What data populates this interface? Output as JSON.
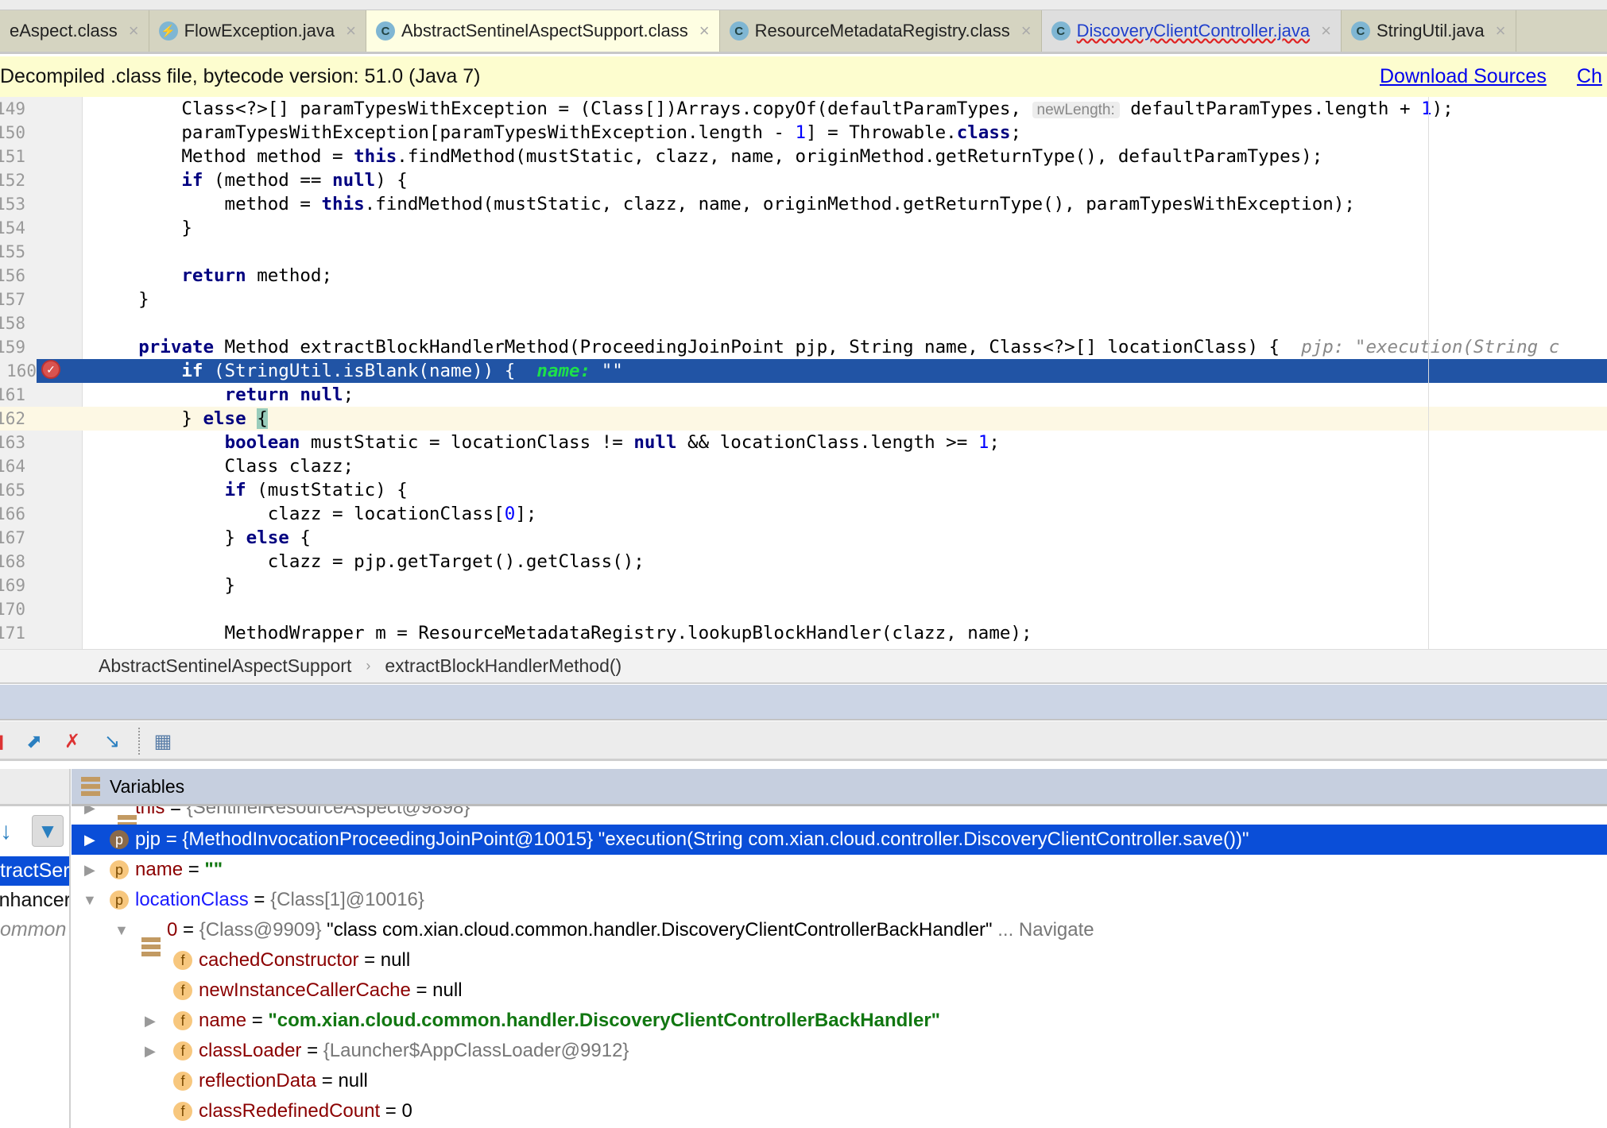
{
  "tabs": [
    {
      "label": "eAspect.class",
      "icon": "",
      "state": "normal"
    },
    {
      "label": "FlowException.java",
      "icon": "⚡",
      "state": "normal"
    },
    {
      "label": "AbstractSentinelAspectSupport.class",
      "icon": "C",
      "state": "active"
    },
    {
      "label": "ResourceMetadataRegistry.class",
      "icon": "C",
      "state": "normal"
    },
    {
      "label": "DiscoveryClientController.java",
      "icon": "C",
      "state": "link"
    },
    {
      "label": "StringUtil.java",
      "icon": "C",
      "state": "normal"
    }
  ],
  "tab_close": "×",
  "banner": {
    "text": "Decompiled .class file, bytecode version: 51.0 (Java 7)",
    "download": "Download Sources",
    "choose": "Ch"
  },
  "colors": {
    "selection": "#2154a5",
    "tree_selection": "#0a4ed8",
    "current_line": "#fdf8e4",
    "keyword": "#000080",
    "number": "#0000ff",
    "string": "#117711"
  },
  "code": {
    "selected_line": "160",
    "current_line": "162",
    "breakpoint_line": "160",
    "lines": [
      {
        "no": "149",
        "t": [
          [
            "        Class<?>[] paramTypesWithException = (Class[])Arrays.copyOf(defaultParamTypes, ",
            ""
          ],
          [
            "newLength:",
            "h"
          ],
          [
            " defaultParamTypes.length + ",
            ""
          ],
          [
            "1",
            "n"
          ],
          [
            ");",
            ""
          ]
        ]
      },
      {
        "no": "150",
        "t": [
          [
            "        paramTypesWithException[paramTypesWithException.length - ",
            ""
          ],
          [
            "1",
            "n"
          ],
          [
            "] = Throwable.",
            ""
          ],
          [
            "class",
            "k"
          ],
          [
            ";",
            ""
          ]
        ]
      },
      {
        "no": "151",
        "t": [
          [
            "        Method method = ",
            ""
          ],
          [
            "this",
            "k"
          ],
          [
            ".findMethod(mustStatic, clazz, name, originMethod.getReturnType(), defaultParamTypes);",
            ""
          ]
        ]
      },
      {
        "no": "152",
        "t": [
          [
            "        ",
            ""
          ],
          [
            "if",
            "k"
          ],
          [
            " (method == ",
            ""
          ],
          [
            "null",
            "k"
          ],
          [
            ") {",
            ""
          ]
        ]
      },
      {
        "no": "153",
        "t": [
          [
            "            method = ",
            ""
          ],
          [
            "this",
            "k"
          ],
          [
            ".findMethod(mustStatic, clazz, name, originMethod.getReturnType(), paramTypesWithException);",
            ""
          ]
        ]
      },
      {
        "no": "154",
        "t": [
          [
            "        }",
            ""
          ]
        ]
      },
      {
        "no": "155",
        "t": []
      },
      {
        "no": "156",
        "t": [
          [
            "        ",
            ""
          ],
          [
            "return",
            "k"
          ],
          [
            " method;",
            ""
          ]
        ]
      },
      {
        "no": "157",
        "t": [
          [
            "    }",
            ""
          ]
        ]
      },
      {
        "no": "158",
        "t": []
      },
      {
        "no": "159",
        "t": [
          [
            "    ",
            ""
          ],
          [
            "private",
            "k"
          ],
          [
            " Method extractBlockHandlerMethod(ProceedingJoinPoint pjp, String name, Class<?>[] locationClass) {  ",
            ""
          ],
          [
            "pjp: \"execution(String c",
            "i"
          ]
        ]
      },
      {
        "no": "160",
        "t": [
          [
            "        ",
            ""
          ],
          [
            "if",
            "k"
          ],
          [
            " (StringUtil.isBlank(name)) {  ",
            ""
          ],
          [
            "name: ",
            "g"
          ],
          [
            "\"\"",
            "w"
          ]
        ]
      },
      {
        "no": "161",
        "t": [
          [
            "            ",
            ""
          ],
          [
            "return null",
            "k"
          ],
          [
            ";",
            ""
          ]
        ]
      },
      {
        "no": "162",
        "t": [
          [
            "        } ",
            ""
          ],
          [
            "else",
            "k"
          ],
          [
            " ",
            ""
          ],
          [
            "{",
            "b"
          ]
        ]
      },
      {
        "no": "163",
        "t": [
          [
            "            ",
            ""
          ],
          [
            "boolean",
            "k"
          ],
          [
            " mustStatic = locationClass != ",
            ""
          ],
          [
            "null",
            "k"
          ],
          [
            " && locationClass.length >= ",
            ""
          ],
          [
            "1",
            "n"
          ],
          [
            ";",
            ""
          ]
        ]
      },
      {
        "no": "164",
        "t": [
          [
            "            Class clazz;",
            ""
          ]
        ]
      },
      {
        "no": "165",
        "t": [
          [
            "            ",
            ""
          ],
          [
            "if",
            "k"
          ],
          [
            " (mustStatic) {",
            ""
          ]
        ]
      },
      {
        "no": "166",
        "t": [
          [
            "                clazz = locationClass[",
            ""
          ],
          [
            "0",
            "n"
          ],
          [
            "];",
            ""
          ]
        ]
      },
      {
        "no": "167",
        "t": [
          [
            "            } ",
            ""
          ],
          [
            "else",
            "k"
          ],
          [
            " {",
            ""
          ]
        ]
      },
      {
        "no": "168",
        "t": [
          [
            "                clazz = pjp.getTarget().getClass();",
            ""
          ]
        ]
      },
      {
        "no": "169",
        "t": [
          [
            "            }",
            ""
          ]
        ]
      },
      {
        "no": "170",
        "t": []
      },
      {
        "no": "171",
        "t": [
          [
            "            MethodWrapper m = ResourceMetadataRegistry.lookupBlockHandler(clazz, name);",
            ""
          ]
        ]
      }
    ]
  },
  "breadcrumb": {
    "class": "AbstractSentinelAspectSupport",
    "sep": "›",
    "method": "extractBlockHandlerMethod()"
  },
  "frames": {
    "items": [
      "tractSer",
      "nhancer",
      "ommon"
    ]
  },
  "variables": {
    "title": "Variables",
    "rows": {
      "this": {
        "name": "this",
        "eq": " = ",
        "val": "{SentinelResourceAspect@9898}"
      },
      "pjp": {
        "icon": "p",
        "name": "pjp",
        "eq": " = ",
        "ref": "{MethodInvocationProceedingJoinPoint@10015}",
        "val": " \"execution(String com.xian.cloud.controller.DiscoveryClientController.save())\""
      },
      "name": {
        "icon": "p",
        "name": "name",
        "eq": " = ",
        "val": "\"\""
      },
      "locationClass": {
        "icon": "p",
        "name": "locationClass",
        "eq": " = ",
        "val": "{Class[1]@10016}"
      },
      "item0": {
        "name": "0",
        "eq": " = ",
        "ref": "{Class@9909}",
        "val": " \"class com.xian.cloud.common.handler.DiscoveryClientControllerBackHandler\"",
        "nav": " ... Navigate"
      },
      "cachedConstructor": {
        "icon": "f",
        "name": "cachedConstructor",
        "eq": " = ",
        "val": "null"
      },
      "newInstanceCallerCache": {
        "icon": "f",
        "name": "newInstanceCallerCache",
        "eq": " = ",
        "val": "null"
      },
      "name2": {
        "icon": "f",
        "name": "name",
        "eq": " = ",
        "val": "\"com.xian.cloud.common.handler.DiscoveryClientControllerBackHandler\""
      },
      "classLoader": {
        "icon": "f",
        "name": "classLoader",
        "eq": " = ",
        "val": "{Launcher$AppClassLoader@9912}"
      },
      "reflectionData": {
        "icon": "f",
        "name": "reflectionData",
        "eq": " = ",
        "val": "null"
      },
      "classRedefinedCount": {
        "icon": "f",
        "name": "classRedefinedCount",
        "eq": " = ",
        "val": "0"
      }
    }
  }
}
